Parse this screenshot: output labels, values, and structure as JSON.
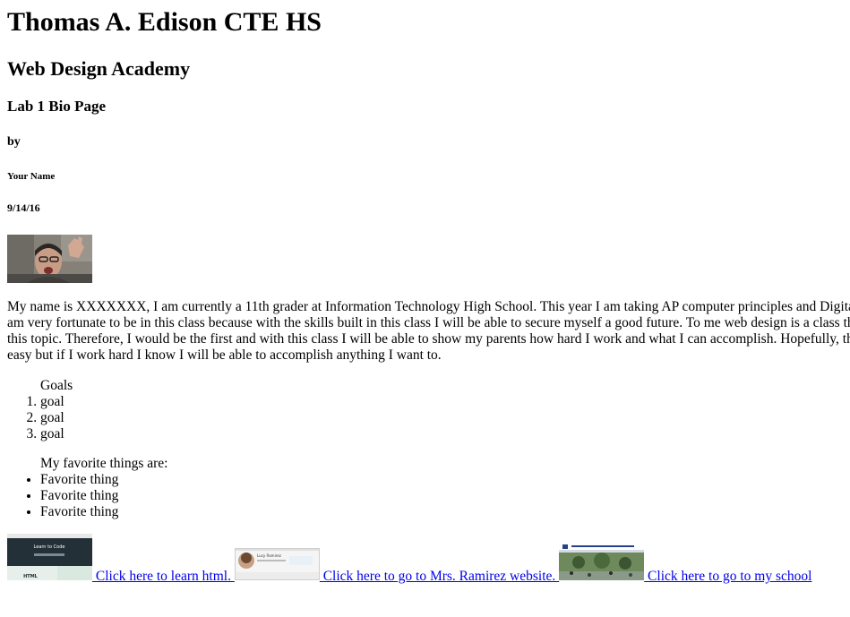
{
  "header": {
    "school": "Thomas A. Edison CTE HS",
    "academy": "Web Design Academy",
    "lab": "Lab 1 Bio Page",
    "by": "by",
    "name": "Your Name",
    "date": "9/14/16"
  },
  "bio": {
    "lines": [
      "My name is XXXXXXX, I am currently a 11th grader at Information Technology High School. This year I am taking AP computer principles and Digital D",
      "am very fortunate to be in this class because with the skills built in this class I will be able to secure myself a good future. To me web design is a class that",
      "this topic. Therefore, I would be the first and with this class I will be able to show my parents how hard I work and what I can accomplish. Hopefully, this",
      "easy but if I work hard I know I will be able to accomplish anything I want to."
    ]
  },
  "goals": {
    "caption": "Goals",
    "items": [
      "goal",
      "goal",
      "goal"
    ]
  },
  "favorites": {
    "caption": "My favorite things are:",
    "items": [
      "Favorite thing",
      "Favorite thing",
      "Favorite thing"
    ]
  },
  "links": [
    {
      "label": " Click here to learn html. ",
      "thumb_text": "Learn to Code",
      "thumb_text2": "HTML"
    },
    {
      "label": " Click here to go to Mrs. Ramirez website. ",
      "thumb_text": "Lucy Ramirez"
    },
    {
      "label": " Click here to go to my school"
    }
  ],
  "colors": {
    "link": "#0000ee",
    "text": "#000000",
    "background": "#ffffff"
  }
}
